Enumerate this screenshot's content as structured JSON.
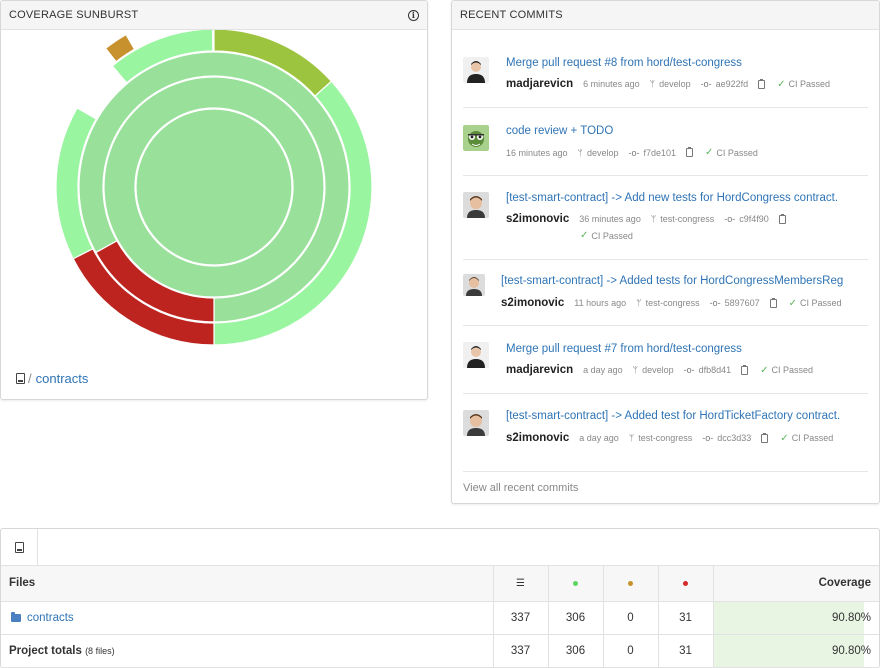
{
  "sunburst": {
    "title": "COVERAGE SUNBURST",
    "info_icon": "info-icon",
    "breadcrumb": {
      "root_icon": "repo-icon",
      "separator": "/",
      "current": "contracts"
    },
    "colors": {
      "full": "#99e09a",
      "ring": "#9af5a0",
      "olive": "#9dc43e",
      "red": "#bd2420",
      "orange": "#c7922e"
    }
  },
  "commits": {
    "title": "RECENT COMMITS",
    "view_all": "View all recent commits",
    "items": [
      {
        "title": "Merge pull request #8 from hord/test-congress",
        "author": "madjarevicn",
        "time": "6 minutes ago",
        "branch": "develop",
        "sha": "ae922fd",
        "ci": "CI Passed",
        "avatar": "avatar-person"
      },
      {
        "title": "code review + TODO",
        "author": "",
        "time": "16 minutes ago",
        "branch": "develop",
        "sha": "f7de101",
        "ci": "CI Passed",
        "avatar": "avatar-mascot"
      },
      {
        "title": "[test-smart-contract] -> Add new tests for HordCongress contract.",
        "author": "s2imonovic",
        "time": "36 minutes ago",
        "branch": "test-congress",
        "sha": "c9f4f90",
        "ci": "CI Passed",
        "avatar": "avatar-person"
      },
      {
        "title": "[test-smart-contract] -> Added tests for HordCongressMembersRegistry",
        "author": "s2imonovic",
        "time": "11 hours ago",
        "branch": "test-congress",
        "sha": "5897607",
        "ci": "CI Passed",
        "avatar": "avatar-person"
      },
      {
        "title": "Merge pull request #7 from hord/test-congress",
        "author": "madjarevicn",
        "time": "a day ago",
        "branch": "develop",
        "sha": "dfb8d41",
        "ci": "CI Passed",
        "avatar": "avatar-person"
      },
      {
        "title": "[test-smart-contract] -> Added test for HordTicketFactory contract.",
        "author": "s2imonovic",
        "time": "a day ago",
        "branch": "test-congress",
        "sha": "dcc3d33",
        "ci": "CI Passed",
        "avatar": "avatar-person"
      }
    ]
  },
  "files": {
    "tab_icon": "repo-icon",
    "headers": {
      "files": "Files",
      "lines_icon": "list-icon",
      "hit_color": "#5cd65c",
      "partial_color": "#c7922e",
      "miss_color": "#d42a2a",
      "coverage": "Coverage"
    },
    "rows": [
      {
        "name": "contracts",
        "lines": "337",
        "hit": "306",
        "partial": "0",
        "miss": "31",
        "coverage": "90.80%",
        "coverage_fraction": 0.908
      },
      {
        "name": "Project totals",
        "note": "(8 files)",
        "lines": "337",
        "hit": "306",
        "partial": "0",
        "miss": "31",
        "coverage": "90.80%",
        "coverage_fraction": 0.908
      }
    ]
  }
}
